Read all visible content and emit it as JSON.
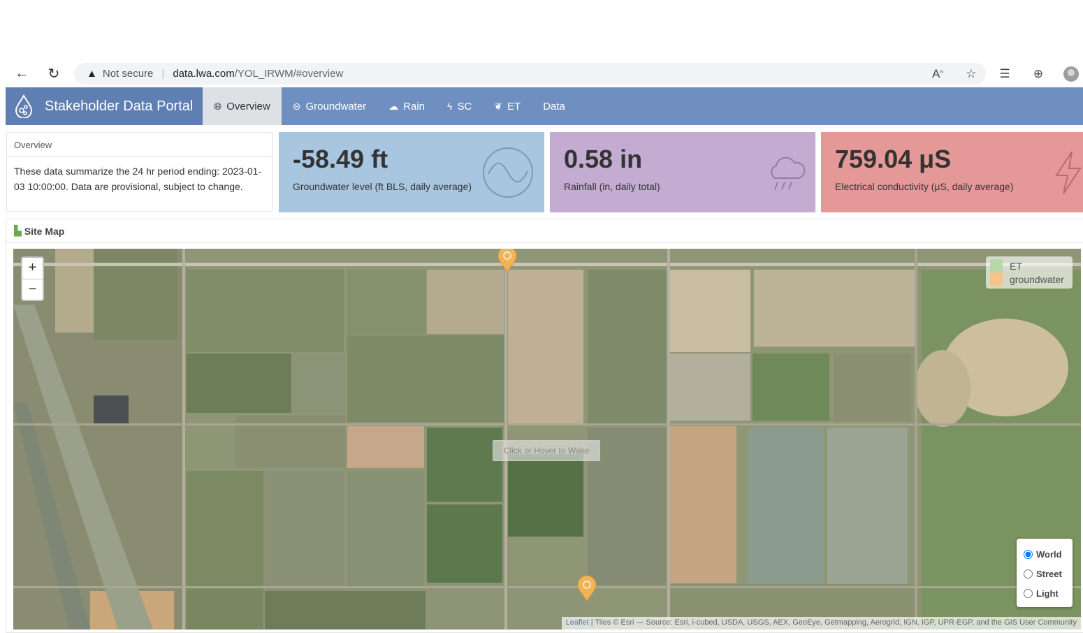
{
  "browser": {
    "security_label": "Not secure",
    "url_host": "data.lwa.com",
    "url_path": "/YOL_IRWM/#overview"
  },
  "app": {
    "title": "Stakeholder Data Portal",
    "tabs": [
      {
        "label": "Overview",
        "icon": "globe-icon",
        "active": true
      },
      {
        "label": "Groundwater",
        "icon": "wave-icon"
      },
      {
        "label": "Rain",
        "icon": "rain-icon"
      },
      {
        "label": "SC",
        "icon": "bolt-icon"
      },
      {
        "label": "ET",
        "icon": "leaf-icon"
      },
      {
        "label": "Data"
      }
    ]
  },
  "overview": {
    "heading": "Overview",
    "text": "These data summarize the 24 hr period ending: 2023-01-03 10:00:00. Data are provisional, subject to change."
  },
  "metrics": {
    "groundwater": {
      "value": "-58.49 ft",
      "label": "Groundwater level (ft BLS, daily average)",
      "color": "#a8c6df"
    },
    "rainfall": {
      "value": "0.58 in",
      "label": "Rainfall (in, daily total)",
      "color": "#c3abd1"
    },
    "conductivity": {
      "value": "759.04 μS",
      "label": "Electrical conductivity (μS, daily average)",
      "color": "#e59898"
    }
  },
  "site_map": {
    "heading": "Site Map",
    "zoom_in": "+",
    "zoom_out": "−",
    "legend": [
      {
        "label": "ET",
        "color": "#b9d7a8"
      },
      {
        "label": "groundwater",
        "color": "#f5c38b"
      }
    ],
    "wake_message": "Click or Hover to Wake",
    "base_layers": [
      {
        "label": "World",
        "selected": true
      },
      {
        "label": "Street",
        "selected": false
      },
      {
        "label": "Light",
        "selected": false
      }
    ],
    "attribution_link": "Leaflet",
    "attribution_text": " | Tiles © Esri — Source: Esri, i-cubed, USDA, USGS, AEX, GeoEye, Getmapping, Aerogrid, IGN, IGP, UPR-EGP, and the GIS User Community",
    "marker_color": "#f0b355"
  }
}
